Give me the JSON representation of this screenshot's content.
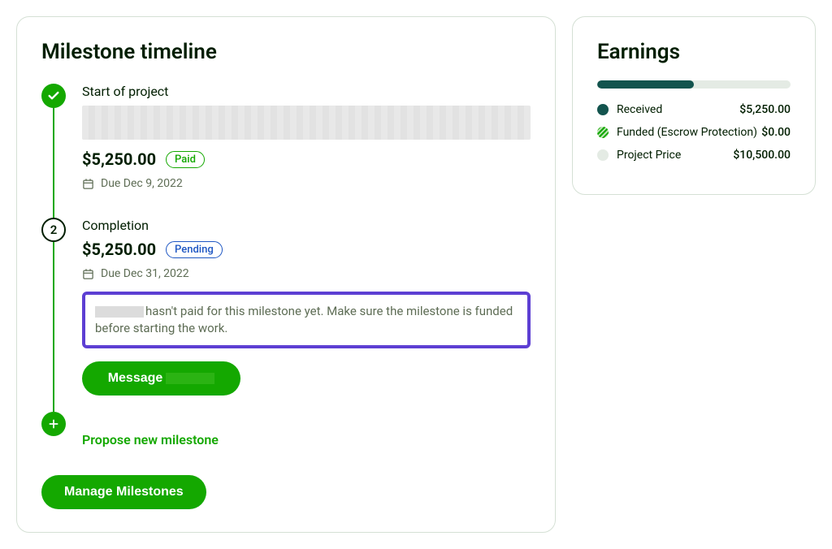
{
  "timeline": {
    "heading": "Milestone timeline",
    "milestones": [
      {
        "title": "Start of project",
        "amount": "$5,250.00",
        "status": "Paid",
        "due": "Due Dec 9, 2022",
        "marker": "check"
      },
      {
        "title": "Completion",
        "amount": "$5,250.00",
        "status": "Pending",
        "due": "Due Dec 31, 2022",
        "marker": "2",
        "warning": "hasn't paid for this milestone yet. Make sure the milestone is funded before starting the work.",
        "messageBtn": "Message"
      }
    ],
    "proposeLink": "Propose new milestone",
    "manageBtn": "Manage Milestones"
  },
  "earnings": {
    "heading": "Earnings",
    "progressPercent": 50,
    "rows": [
      {
        "label": "Received",
        "value": "$5,250.00",
        "dot": "received"
      },
      {
        "label": "Funded (Escrow Protection)",
        "value": "$0.00",
        "dot": "funded"
      },
      {
        "label": "Project Price",
        "value": "$10,500.00",
        "dot": "price"
      }
    ]
  }
}
